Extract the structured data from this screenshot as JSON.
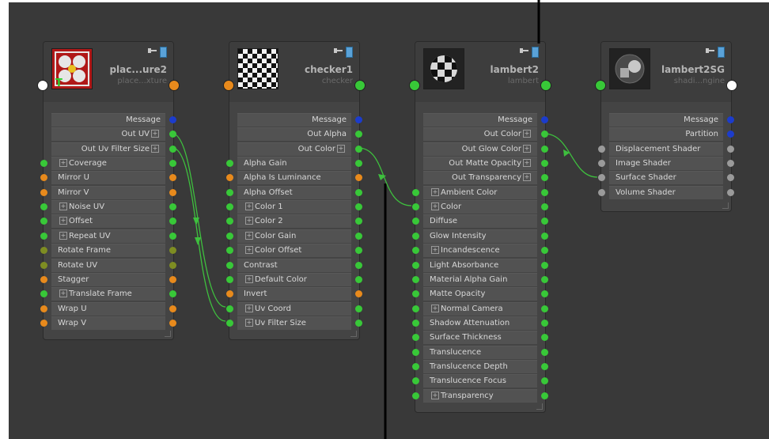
{
  "nodes": {
    "place2d": {
      "title": "plac...ure2",
      "subtitle": "place...xture",
      "attrs": [
        {
          "label": "Message",
          "align": "right",
          "out": "blue"
        },
        {
          "label": "Out UV",
          "align": "right",
          "plus": true,
          "out": "green"
        },
        {
          "label": "Out Uv Filter Size",
          "align": "right",
          "plus": true,
          "out": "green"
        },
        {
          "label": "Coverage",
          "align": "left",
          "plus": true,
          "in": "green",
          "out": "green"
        },
        {
          "label": "Mirror U",
          "align": "left",
          "in": "orange",
          "out": "orange"
        },
        {
          "label": "Mirror V",
          "align": "left",
          "in": "orange",
          "out": "orange"
        },
        {
          "label": "Noise UV",
          "align": "left",
          "plus": true,
          "in": "green",
          "out": "green"
        },
        {
          "label": "Offset",
          "align": "left",
          "plus": true,
          "in": "green",
          "out": "green"
        },
        {
          "label": "Repeat UV",
          "align": "left",
          "plus": true,
          "in": "green",
          "out": "green"
        },
        {
          "label": "Rotate Frame",
          "align": "left",
          "in": "olive",
          "out": "olive"
        },
        {
          "label": "Rotate UV",
          "align": "left",
          "in": "olive",
          "out": "olive"
        },
        {
          "label": "Stagger",
          "align": "left",
          "in": "orange",
          "out": "orange"
        },
        {
          "label": "Translate Frame",
          "align": "left",
          "plus": true,
          "in": "green",
          "out": "green"
        },
        {
          "label": "Wrap U",
          "align": "left",
          "in": "orange",
          "out": "orange"
        },
        {
          "label": "Wrap V",
          "align": "left",
          "in": "orange",
          "out": "orange"
        }
      ]
    },
    "checker": {
      "title": "checker1",
      "subtitle": "checker",
      "attrs": [
        {
          "label": "Message",
          "align": "right",
          "out": "blue"
        },
        {
          "label": "Out Alpha",
          "align": "right",
          "out": "green"
        },
        {
          "label": "Out Color",
          "align": "right",
          "plus": true,
          "out": "green"
        },
        {
          "label": "Alpha Gain",
          "align": "left",
          "in": "green",
          "out": "green"
        },
        {
          "label": "Alpha Is Luminance",
          "align": "left",
          "in": "orange",
          "out": "orange"
        },
        {
          "label": "Alpha Offset",
          "align": "left",
          "in": "green",
          "out": "green"
        },
        {
          "label": "Color 1",
          "align": "left",
          "plus": true,
          "in": "green",
          "out": "green"
        },
        {
          "label": "Color 2",
          "align": "left",
          "plus": true,
          "in": "green",
          "out": "green"
        },
        {
          "label": "Color Gain",
          "align": "left",
          "plus": true,
          "in": "green",
          "out": "green"
        },
        {
          "label": "Color Offset",
          "align": "left",
          "plus": true,
          "in": "green",
          "out": "green"
        },
        {
          "label": "Contrast",
          "align": "left",
          "in": "green",
          "out": "green"
        },
        {
          "label": "Default Color",
          "align": "left",
          "plus": true,
          "in": "green",
          "out": "green"
        },
        {
          "label": "Invert",
          "align": "left",
          "in": "orange",
          "out": "orange"
        },
        {
          "label": "Uv Coord",
          "align": "left",
          "plus": true,
          "in": "green",
          "out": "green"
        },
        {
          "label": "Uv Filter Size",
          "align": "left",
          "plus": true,
          "in": "green",
          "out": "green"
        }
      ]
    },
    "lambert": {
      "title": "lambert2",
      "subtitle": "lambert",
      "attrs": [
        {
          "label": "Message",
          "align": "right",
          "out": "blue"
        },
        {
          "label": "Out Color",
          "align": "right",
          "plus": true,
          "out": "green"
        },
        {
          "label": "Out Glow Color",
          "align": "right",
          "plus": true,
          "out": "green"
        },
        {
          "label": "Out Matte Opacity",
          "align": "right",
          "plus": true,
          "out": "green"
        },
        {
          "label": "Out Transparency",
          "align": "right",
          "plus": true,
          "out": "green"
        },
        {
          "label": "Ambient Color",
          "align": "left",
          "plus": true,
          "in": "green",
          "out": "green"
        },
        {
          "label": "Color",
          "align": "left",
          "plus": true,
          "in": "green",
          "out": "green"
        },
        {
          "label": "Diffuse",
          "align": "left",
          "in": "green",
          "out": "green"
        },
        {
          "label": "Glow Intensity",
          "align": "left",
          "in": "green",
          "out": "green"
        },
        {
          "label": "Incandescence",
          "align": "left",
          "plus": true,
          "in": "green",
          "out": "green"
        },
        {
          "label": "Light Absorbance",
          "align": "left",
          "in": "green",
          "out": "green"
        },
        {
          "label": "Material Alpha Gain",
          "align": "left",
          "in": "green",
          "out": "green"
        },
        {
          "label": "Matte Opacity",
          "align": "left",
          "in": "green",
          "out": "green"
        },
        {
          "label": "Normal Camera",
          "align": "left",
          "plus": true,
          "in": "green",
          "out": "green"
        },
        {
          "label": "Shadow Attenuation",
          "align": "left",
          "in": "green",
          "out": "green"
        },
        {
          "label": "Surface Thickness",
          "align": "left",
          "in": "green",
          "out": "green"
        },
        {
          "label": "Translucence",
          "align": "left",
          "in": "green",
          "out": "green"
        },
        {
          "label": "Translucence Depth",
          "align": "left",
          "in": "green",
          "out": "green"
        },
        {
          "label": "Translucence Focus",
          "align": "left",
          "in": "green",
          "out": "green"
        },
        {
          "label": "Transparency",
          "align": "left",
          "plus": true,
          "in": "green",
          "out": "green"
        }
      ]
    },
    "sg": {
      "title": "lambert2SG",
      "subtitle": "shadi...ngine",
      "attrs": [
        {
          "label": "Message",
          "align": "right",
          "out": "blue"
        },
        {
          "label": "Partition",
          "align": "right",
          "out": "blue"
        },
        {
          "label": "Displacement Shader",
          "align": "left",
          "in": "grey",
          "out": "grey"
        },
        {
          "label": "Image Shader",
          "align": "left",
          "in": "grey",
          "out": "grey"
        },
        {
          "label": "Surface Shader",
          "align": "left",
          "in": "grey",
          "out": "grey"
        },
        {
          "label": "Volume Shader",
          "align": "left",
          "in": "grey",
          "out": "grey"
        }
      ]
    }
  },
  "colors": {
    "canvas": "#393939",
    "node": "#444444",
    "wire": "#3ec03e",
    "green": "#38c838",
    "orange": "#e88a1c",
    "blue": "#1c3ccc",
    "olive": "#7e8d22",
    "grey": "#9a9a9a"
  }
}
